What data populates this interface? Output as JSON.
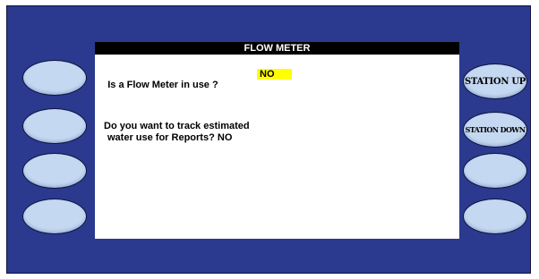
{
  "screen": {
    "title": "FLOW METER",
    "question1_label": "Is a Flow Meter in use ?",
    "question1_value": "NO",
    "question2_line1": "Do you want to track estimated",
    "question2_line2": "water use for Reports?",
    "question2_value": "NO",
    "highlight_color": "#ffff00"
  },
  "right_buttons": [
    {
      "label": "STATION UP"
    },
    {
      "label": "STATION DOWN"
    },
    {
      "label": ""
    },
    {
      "label": ""
    }
  ],
  "colors": {
    "panel": "#2b3a8e",
    "button": "#c5d8f1",
    "title_bar": "#000000"
  }
}
